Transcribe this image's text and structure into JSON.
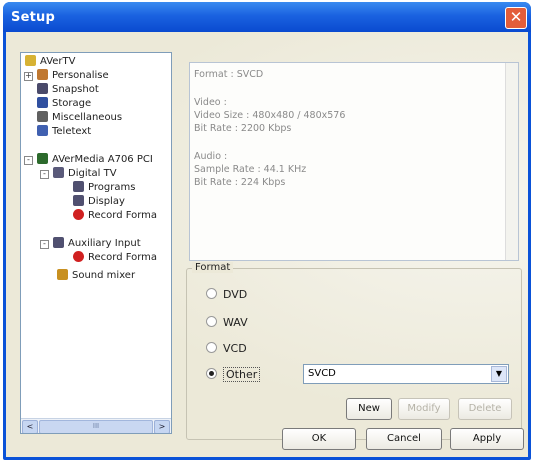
{
  "window": {
    "title": "Setup",
    "close_glyph": "✕"
  },
  "tree": {
    "items": [
      {
        "label": "AVerTV",
        "icon": "aver-logo-icon",
        "color": "#d7b233"
      },
      {
        "label": "Personalise",
        "icon": "personalise-icon",
        "color": "#c07830"
      },
      {
        "label": "Snapshot",
        "icon": "camera-icon",
        "color": "#4a4a6a"
      },
      {
        "label": "Storage",
        "icon": "disk-icon",
        "color": "#3050a0"
      },
      {
        "label": "Miscellaneous",
        "icon": "tools-icon",
        "color": "#606060"
      },
      {
        "label": "Teletext",
        "icon": "teletext-icon",
        "color": "#4060b0"
      },
      {
        "label": "AVerMedia A706 PCI",
        "icon": "pci-card-icon",
        "color": "#2c6a2c"
      },
      {
        "label": "Digital TV",
        "icon": "digital-tv-icon",
        "color": "#5a5a7a"
      },
      {
        "label": "Programs",
        "icon": "programs-icon",
        "color": "#505070"
      },
      {
        "label": "Display",
        "icon": "display-icon",
        "color": "#505070"
      },
      {
        "label": "Record Forma",
        "icon": "record-icon",
        "color": "#d02020"
      },
      {
        "label": "Auxiliary Input",
        "icon": "aux-input-icon",
        "color": "#505070"
      },
      {
        "label": "Record Forma",
        "icon": "record-icon",
        "color": "#d02020"
      },
      {
        "label": "Sound mixer",
        "icon": "sound-mixer-icon",
        "color": "#c89020"
      }
    ],
    "expanders": [
      "+",
      "-",
      "-",
      "-"
    ],
    "scroll_left": "<",
    "scroll_right": ">",
    "scroll_grip": "III"
  },
  "info": {
    "lines": [
      "Format : SVCD",
      "Video :",
      "Video Size : 480x480 / 480x576",
      "Bit Rate : 2200 Kbps",
      "Audio :",
      "Sample Rate : 44.1 KHz",
      "Bit Rate : 224 Kbps"
    ]
  },
  "format": {
    "legend": "Format",
    "options": [
      "DVD",
      "WAV",
      "VCD",
      "Other"
    ],
    "selected": "Other",
    "select_value": "SVCD",
    "select_arrow": "▼"
  },
  "buttons": {
    "new": "New",
    "modify": "Modify",
    "delete": "Delete",
    "ok": "OK",
    "cancel": "Cancel",
    "apply": "Apply"
  }
}
